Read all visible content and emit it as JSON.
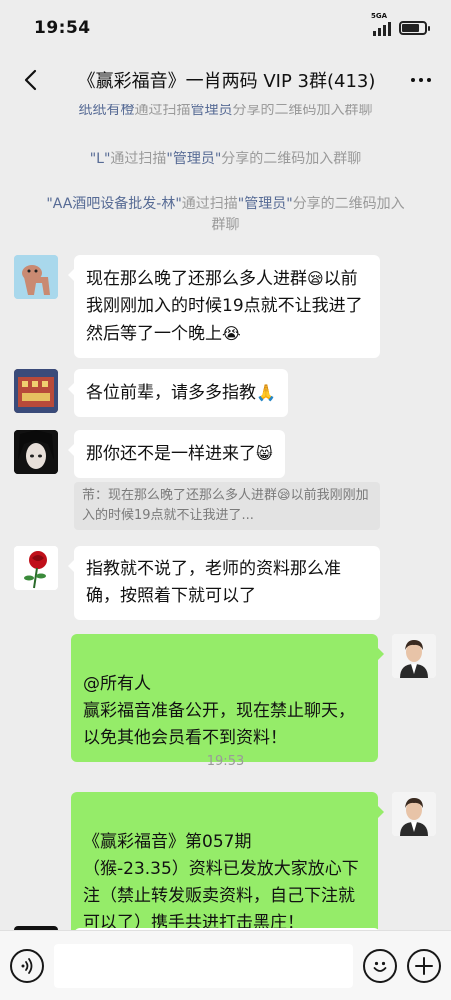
{
  "status": {
    "time": "19:54",
    "network": "5GA"
  },
  "nav": {
    "title": "《赢彩福音》一肖两码 VIP 3群(413)"
  },
  "system_messages": [
    {
      "name": "纸纸有橙",
      "mid": "通过扫描",
      "admin": "管理员",
      "tail": "分享的二维码加入群聊"
    },
    {
      "name": "\"L\"",
      "mid": "通过扫描",
      "admin": "\"管理员\"",
      "tail": "分享的二维码加入群聊"
    },
    {
      "name": "\"AA酒吧设备批发-林\"",
      "mid": "通过扫描",
      "admin": "\"管理员\"",
      "tail": "分享的二维码加入群聊"
    }
  ],
  "messages": [
    {
      "text1": "现在那么晚了还那么多人进群",
      "emoji1": "😪",
      "text2": "以前我刚刚加入的时候19点就不让我进了 然后等了一个晚上",
      "emoji2": "😭"
    },
    {
      "text": "各位前辈，请多多指教",
      "emoji": "🙏"
    },
    {
      "text": "那你还不是一样进来了",
      "emoji": "😸",
      "quote_a": "芾：现在那么晚了还那么多人进群",
      "quote_emoji": "😪",
      "quote_b": "以前我刚刚加入的时候19点就不让我进了..."
    },
    {
      "text": "指教就不说了，老师的资料那么准确，按照着下就可以了"
    },
    {
      "text": "@所有人\n赢彩福音准备公开，现在禁止聊天，以免其他会员看不到资料！"
    },
    {
      "text": "《赢彩福音》第057期\n（猴-23.35）资料已发放大家放心下注（禁止转发贩卖资料，自己下注就可以了）携手共进打击黑庄！"
    }
  ],
  "timestamp": "19:53",
  "colors": {
    "right_bubble": "#95ec69",
    "link": "#576b95",
    "background": "#ededed"
  },
  "icons": {
    "voice": "voice-icon",
    "emoji": "emoji-icon",
    "plus": "plus-icon"
  }
}
